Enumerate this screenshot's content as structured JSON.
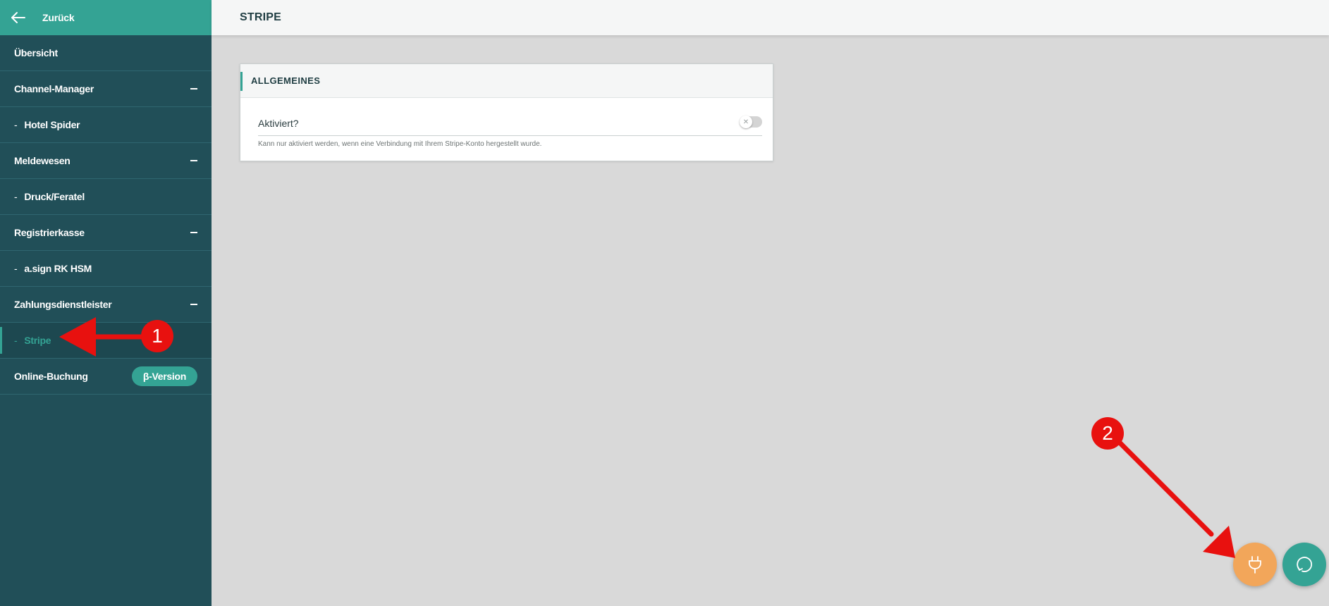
{
  "sidebar": {
    "back_label": "Zurück",
    "items": [
      {
        "label": "Übersicht"
      },
      {
        "label": "Channel-Manager"
      },
      {
        "label": "Hotel Spider"
      },
      {
        "label": "Meldewesen"
      },
      {
        "label": "Druck/Feratel"
      },
      {
        "label": "Registrierkasse"
      },
      {
        "label": "a.sign RK HSM"
      },
      {
        "label": "Zahlungsdienstleister"
      },
      {
        "label": "Stripe"
      },
      {
        "label": "Online-Buchung"
      }
    ],
    "sub_prefix": "-",
    "beta_badge": "β-Version",
    "accent": "#34a394",
    "background": "#214f58"
  },
  "header": {
    "title": "STRIPE"
  },
  "card": {
    "title": "ALLGEMEINES",
    "field_label": "Aktiviert?",
    "toggle_on": false,
    "hint": "Kann nur aktiviert werden, wenn eine Verbindung mit Ihrem Stripe-Konto hergestellt wurde."
  },
  "fabs": {
    "plug_icon": "plug-icon",
    "plug_color": "#f2a65a",
    "chat_icon": "chat-icon",
    "chat_color": "#34a394"
  },
  "annotations": {
    "marker_1": "1",
    "marker_2": "2",
    "color": "#e8110f"
  }
}
